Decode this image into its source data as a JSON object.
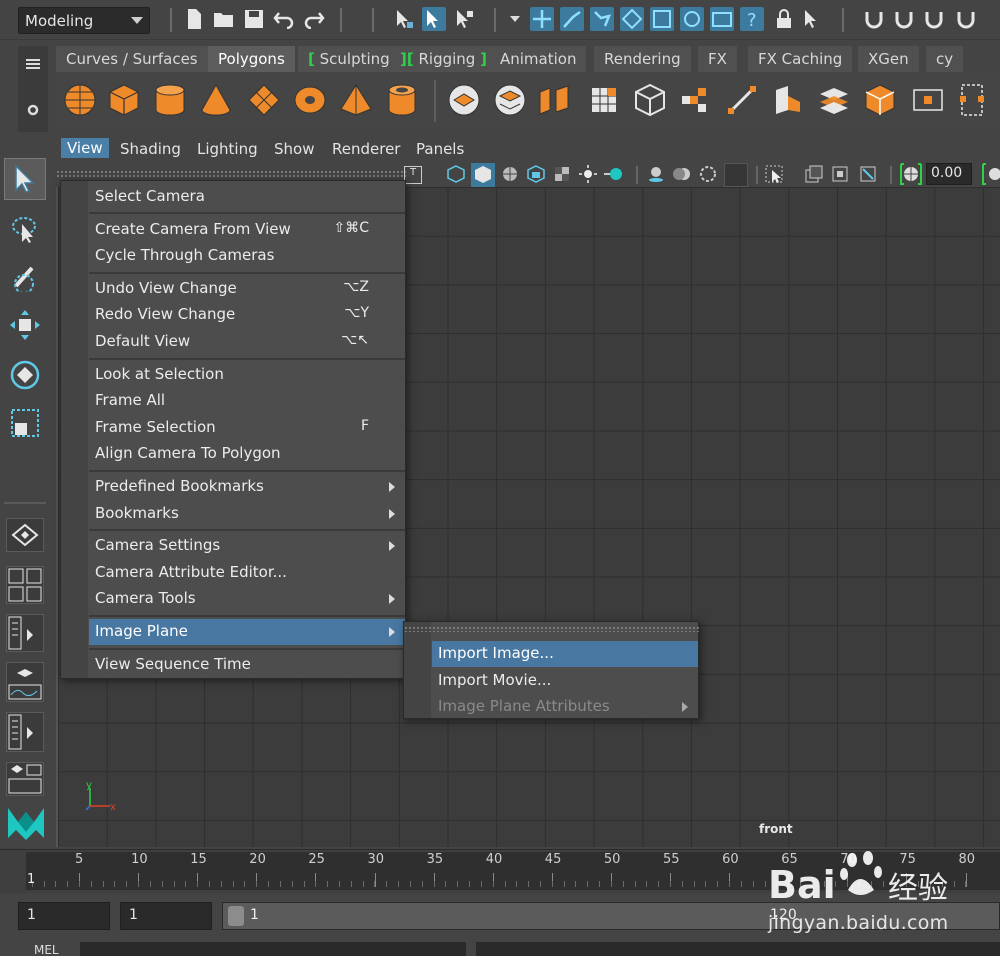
{
  "statusline": {
    "mode": "Modeling"
  },
  "shelf": {
    "tabs": [
      {
        "label": "Curves / Surfaces",
        "active": false
      },
      {
        "label": "Polygons",
        "active": true
      },
      {
        "label": "Sculpting",
        "active": false
      },
      {
        "label": "Rigging",
        "active": false
      },
      {
        "label": "Animation",
        "active": false
      },
      {
        "label": "Rendering",
        "active": false
      },
      {
        "label": "FX",
        "active": false
      },
      {
        "label": "FX Caching",
        "active": false
      },
      {
        "label": "XGen",
        "active": false
      },
      {
        "label": "cy",
        "active": false
      }
    ]
  },
  "panel_menu": {
    "items": [
      "View",
      "Shading",
      "Lighting",
      "Show",
      "Renderer",
      "Panels"
    ],
    "active": "View"
  },
  "viewport": {
    "frame_value": "0.00",
    "camera_label": "front",
    "axis_y": "y",
    "axis_x": "x"
  },
  "view_menu": {
    "items": [
      {
        "label": "Select Camera",
        "shortcut": "",
        "submenu": false
      },
      {
        "label": "Create Camera From View",
        "shortcut": "⇧⌘C",
        "submenu": false
      },
      {
        "label": "Cycle Through Cameras",
        "shortcut": "",
        "submenu": false
      },
      {
        "label": "Undo View Change",
        "shortcut": "⌥Z",
        "submenu": false
      },
      {
        "label": "Redo View Change",
        "shortcut": "⌥Y",
        "submenu": false
      },
      {
        "label": "Default View",
        "shortcut": "⌥↖",
        "submenu": false
      },
      {
        "label": "Look at Selection",
        "shortcut": "",
        "submenu": false
      },
      {
        "label": "Frame All",
        "shortcut": "",
        "submenu": false
      },
      {
        "label": "Frame Selection",
        "shortcut": "F",
        "submenu": false
      },
      {
        "label": "Align Camera To Polygon",
        "shortcut": "",
        "submenu": false
      },
      {
        "label": "Predefined Bookmarks",
        "shortcut": "",
        "submenu": true
      },
      {
        "label": "Bookmarks",
        "shortcut": "",
        "submenu": true
      },
      {
        "label": "Camera Settings",
        "shortcut": "",
        "submenu": true
      },
      {
        "label": "Camera Attribute Editor...",
        "shortcut": "",
        "submenu": false
      },
      {
        "label": "Camera Tools",
        "shortcut": "",
        "submenu": true
      },
      {
        "label": "Image Plane",
        "shortcut": "",
        "submenu": true,
        "highlighted": true
      },
      {
        "label": "View Sequence Time",
        "shortcut": "",
        "submenu": false
      }
    ]
  },
  "image_plane_submenu": {
    "items": [
      {
        "label": "Import Image...",
        "highlighted": true,
        "disabled": false
      },
      {
        "label": "Import Movie...",
        "highlighted": false,
        "disabled": false
      },
      {
        "label": "Image Plane Attributes",
        "highlighted": false,
        "disabled": true,
        "submenu": true
      }
    ]
  },
  "timeline": {
    "current_frame": "1",
    "ticks": [
      "5",
      "10",
      "15",
      "20",
      "25",
      "30",
      "35",
      "40",
      "45",
      "50",
      "55",
      "60",
      "65",
      "70",
      "75",
      "80"
    ]
  },
  "range": {
    "start": "1",
    "anim_start": "1",
    "inner_start": "1",
    "inner_end": "120"
  },
  "cmdline": {
    "label": "MEL"
  },
  "watermark": {
    "brand": "Bai",
    "brand_cn": "经验",
    "url": "jingyan.baidu.com"
  },
  "colors": {
    "accent_orange": "#ef8a2a",
    "highlight_blue": "#4877a1",
    "toolbar_blue": "#3c7a9e",
    "bracket_green": "#2fd14b"
  }
}
